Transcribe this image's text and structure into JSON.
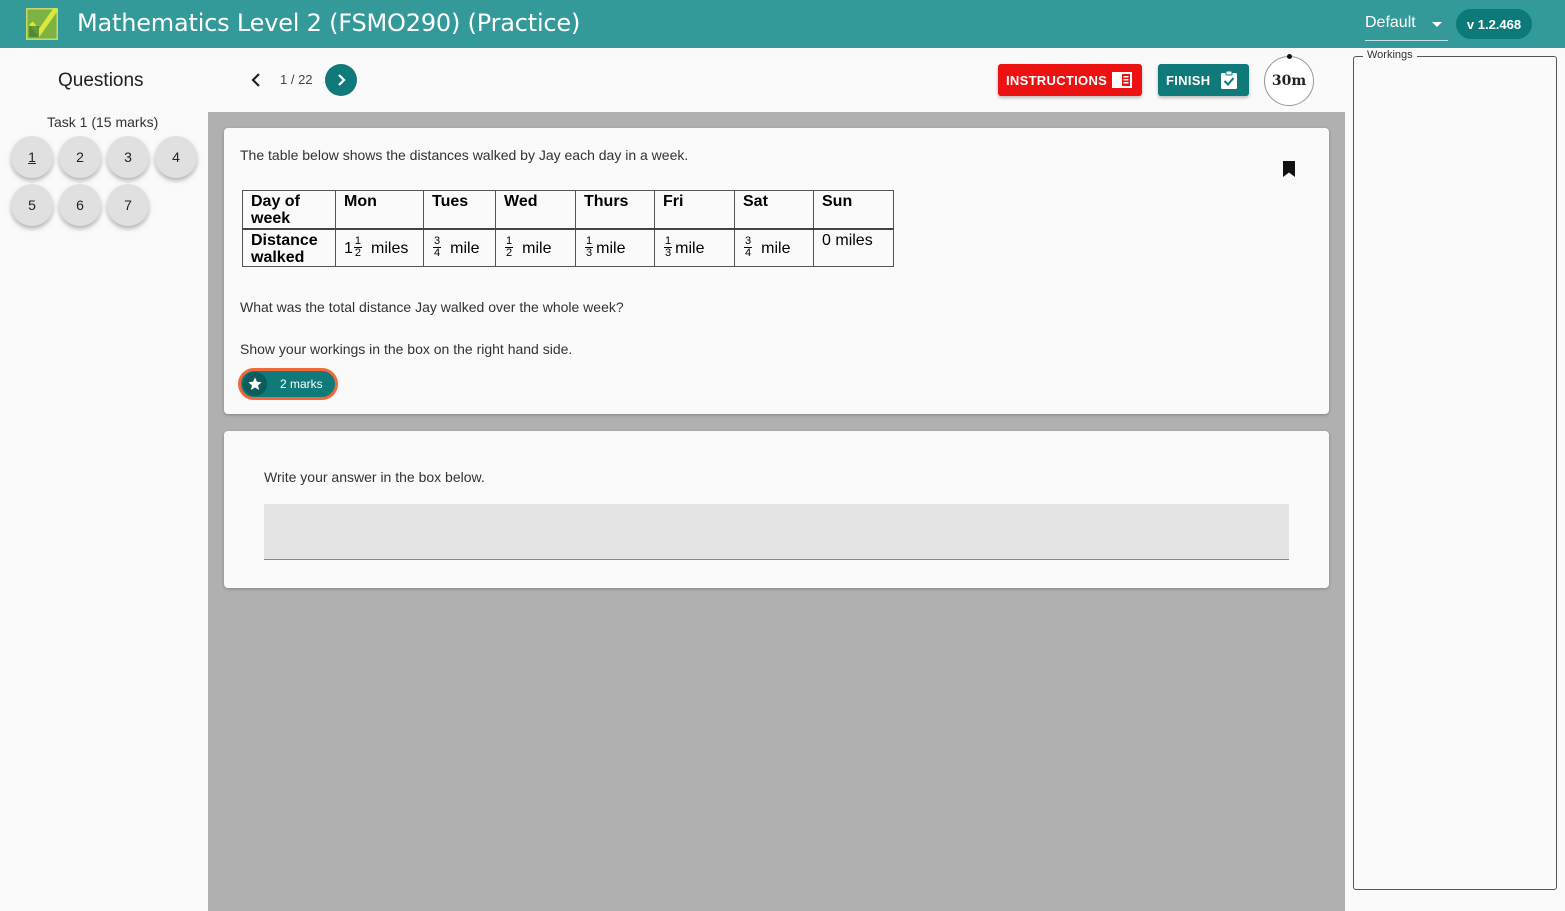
{
  "appbar": {
    "title": "Mathematics Level 2 (FSMO290) (Practice)",
    "theme_value": "Default",
    "version": "v 1.2.468",
    "bar_color": "#339a99",
    "accent_color": "#0f7a79"
  },
  "sidebar": {
    "heading": "Questions",
    "task_label": "Task 1 (15 marks)",
    "questions": [
      "1",
      "2",
      "3",
      "4",
      "5",
      "6",
      "7"
    ],
    "current_question": "1"
  },
  "toolbar": {
    "page_indicator": "1 / 22",
    "instructions_label": "INSTRUCTIONS",
    "finish_label": "FINISH",
    "timer": "30m"
  },
  "question": {
    "intro": "The table below shows the distances walked by Jay each day in a week.",
    "table": {
      "header_row_label": "Day of week",
      "data_row_label": "Distance walked",
      "days": [
        "Mon",
        "Tues",
        "Wed",
        "Thurs",
        "Fri",
        "Sat",
        "Sun"
      ],
      "distances": [
        {
          "whole": "1",
          "num": "1",
          "den": "2",
          "unit": "miles"
        },
        {
          "whole": "",
          "num": "3",
          "den": "4",
          "unit": "mile"
        },
        {
          "whole": "",
          "num": "1",
          "den": "2",
          "unit": "mile"
        },
        {
          "whole": "",
          "num": "1",
          "den": "3",
          "unit": "mile"
        },
        {
          "whole": "",
          "num": "1",
          "den": "3",
          "unit": "mile"
        },
        {
          "whole": "",
          "num": "3",
          "den": "4",
          "unit": "mile"
        },
        {
          "whole": "0",
          "num": "",
          "den": "",
          "unit": "miles"
        }
      ]
    },
    "prompt": "What was the total distance Jay walked over the whole week?",
    "instruction": "Show your workings in the box on the right hand side.",
    "marks_label": "2 marks"
  },
  "answer": {
    "label": "Write your answer in the box below.",
    "value": ""
  },
  "workings": {
    "legend": "Workings"
  }
}
